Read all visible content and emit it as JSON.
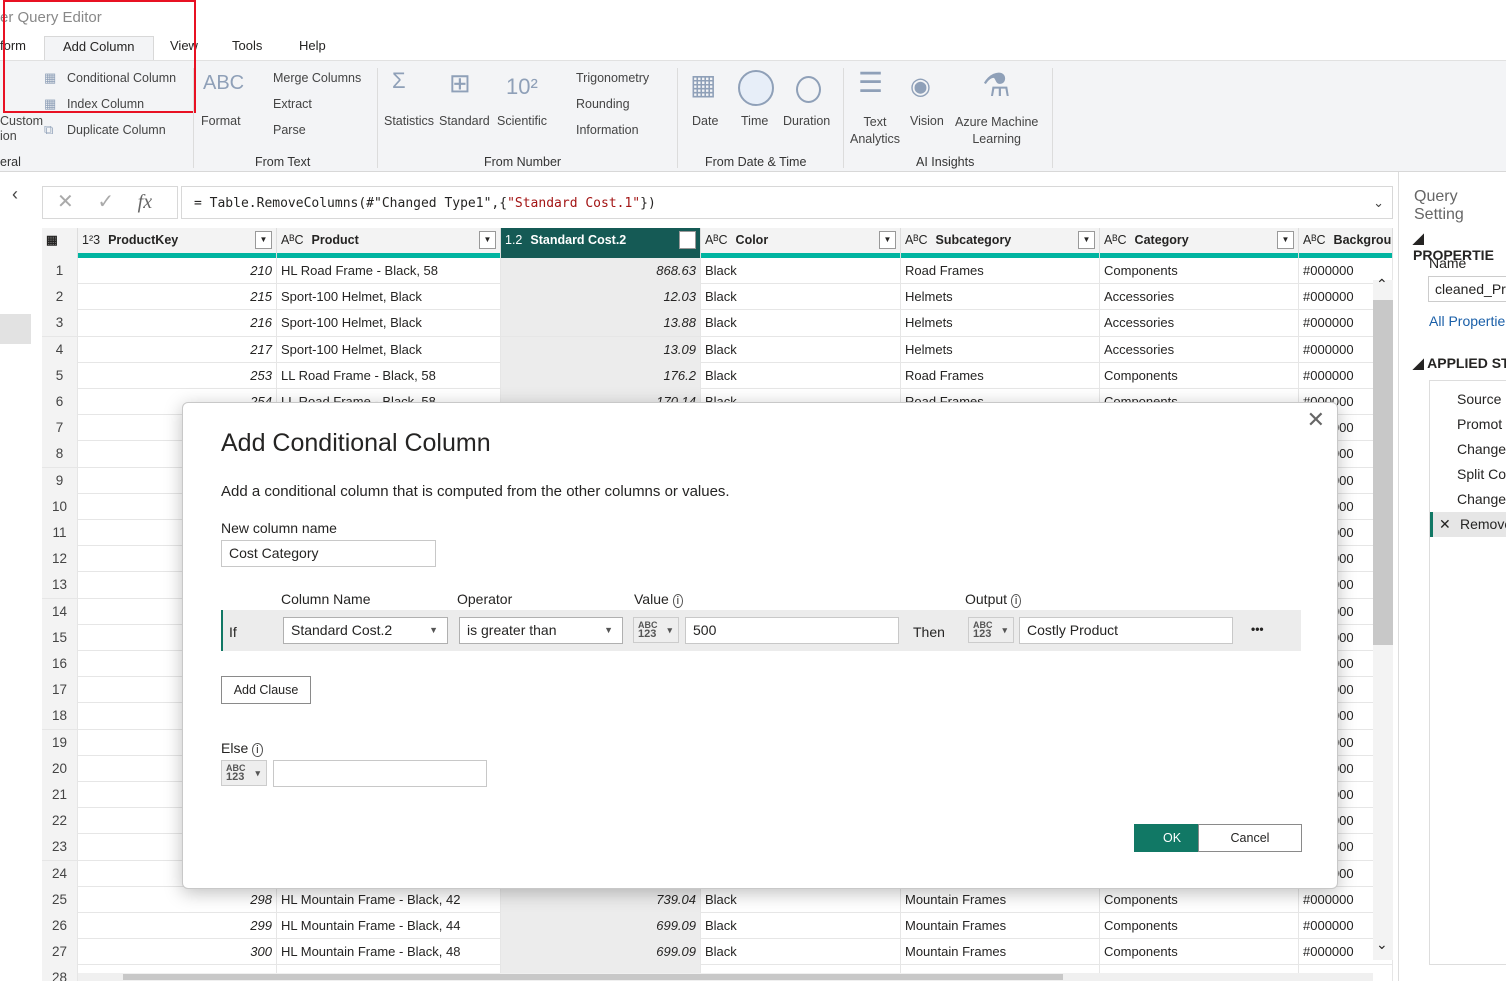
{
  "window": {
    "title": "er Query Editor"
  },
  "tabs": [
    {
      "label": "form"
    },
    {
      "label": "Add Column",
      "active": true
    },
    {
      "label": "View"
    },
    {
      "label": "Tools"
    },
    {
      "label": "Help"
    }
  ],
  "ribbon": {
    "general": {
      "custom_label": "Custom\nion",
      "group": "eral",
      "conditional": "Conditional Column",
      "index": "Index Column",
      "duplicate": "Duplicate Column"
    },
    "text": {
      "format": "Format",
      "merge": "Merge Columns",
      "extract": "Extract",
      "parse": "Parse",
      "group": "From Text"
    },
    "number": {
      "statistics": "Statistics",
      "standard": "Standard",
      "scientific": "Scientific",
      "trig": "Trigonometry",
      "rounding": "Rounding",
      "information": "Information",
      "group": "From Number"
    },
    "datetime": {
      "date": "Date",
      "time": "Time",
      "duration": "Duration",
      "group": "From Date & Time"
    },
    "ai": {
      "text": "Text\nAnalytics",
      "vision": "Vision",
      "azure": "Azure Machine\nLearning",
      "group": "AI Insights"
    }
  },
  "formula": {
    "prefix": "= Table.RemoveColumns(#\"Changed Type1\",{",
    "str": "\"Standard Cost.1\"",
    "suffix": "})"
  },
  "columns": [
    {
      "type": "1²3",
      "name": "ProductKey"
    },
    {
      "type": "AᴮC",
      "name": "Product"
    },
    {
      "type": "1.2",
      "name": "Standard Cost.2",
      "selected": true
    },
    {
      "type": "AᴮC",
      "name": "Color"
    },
    {
      "type": "AᴮC",
      "name": "Subcategory"
    },
    {
      "type": "AᴮC",
      "name": "Category"
    },
    {
      "type": "AᴮC",
      "name": "Backgrour"
    }
  ],
  "rows": [
    [
      "1",
      "210",
      "HL Road Frame - Black, 58",
      "868.63",
      "Black",
      "Road Frames",
      "Components",
      "#000000"
    ],
    [
      "2",
      "215",
      "Sport-100 Helmet, Black",
      "12.03",
      "Black",
      "Helmets",
      "Accessories",
      "#000000"
    ],
    [
      "3",
      "216",
      "Sport-100 Helmet, Black",
      "13.88",
      "Black",
      "Helmets",
      "Accessories",
      "#000000"
    ],
    [
      "4",
      "217",
      "Sport-100 Helmet, Black",
      "13.09",
      "Black",
      "Helmets",
      "Accessories",
      "#000000"
    ],
    [
      "5",
      "253",
      "LL Road Frame - Black, 58",
      "176.2",
      "Black",
      "Road Frames",
      "Components",
      "#000000"
    ],
    [
      "6",
      "254",
      "LL Road Frame - Black, 58",
      "170.14",
      "Black",
      "Road Frames",
      "Components",
      "#000000"
    ],
    [
      "7",
      "",
      "",
      "",
      "",
      "",
      "",
      "#000000"
    ],
    [
      "8",
      "",
      "",
      "",
      "",
      "",
      "",
      "#000000"
    ],
    [
      "9",
      "",
      "",
      "",
      "",
      "",
      "",
      "#000000"
    ],
    [
      "10",
      "",
      "",
      "",
      "",
      "",
      "",
      "#000000"
    ],
    [
      "11",
      "",
      "",
      "",
      "",
      "",
      "",
      "#000000"
    ],
    [
      "12",
      "",
      "",
      "",
      "",
      "",
      "",
      "#000000"
    ],
    [
      "13",
      "",
      "",
      "",
      "",
      "",
      "",
      "#000000"
    ],
    [
      "14",
      "",
      "",
      "",
      "",
      "",
      "",
      "#000000"
    ],
    [
      "15",
      "",
      "",
      "",
      "",
      "",
      "",
      "#000000"
    ],
    [
      "16",
      "",
      "",
      "",
      "",
      "",
      "",
      "#000000"
    ],
    [
      "17",
      "",
      "",
      "",
      "",
      "",
      "",
      "#000000"
    ],
    [
      "18",
      "",
      "",
      "",
      "",
      "",
      "",
      "#000000"
    ],
    [
      "19",
      "",
      "",
      "",
      "",
      "",
      "",
      "#000000"
    ],
    [
      "20",
      "",
      "",
      "",
      "",
      "",
      "",
      "#000000"
    ],
    [
      "21",
      "",
      "",
      "",
      "",
      "",
      "",
      "#000000"
    ],
    [
      "22",
      "",
      "",
      "",
      "",
      "",
      "",
      "#000000"
    ],
    [
      "23",
      "",
      "",
      "",
      "",
      "",
      "",
      "#000000"
    ],
    [
      "24",
      "",
      "",
      "",
      "",
      "",
      "",
      "#000000"
    ],
    [
      "25",
      "298",
      "HL Mountain Frame - Black, 42",
      "739.04",
      "Black",
      "Mountain Frames",
      "Components",
      "#000000"
    ],
    [
      "26",
      "299",
      "HL Mountain Frame - Black, 44",
      "699.09",
      "Black",
      "Mountain Frames",
      "Components",
      "#000000"
    ],
    [
      "27",
      "300",
      "HL Mountain Frame - Black, 48",
      "699.09",
      "Black",
      "Mountain Frames",
      "Components",
      "#000000"
    ],
    [
      "28",
      "",
      "",
      "",
      "",
      "",
      "",
      ""
    ]
  ],
  "query_settings": {
    "title": "Query Setting",
    "properties": "PROPERTIE",
    "name_label": "Name",
    "name_value": "cleaned_Pro",
    "all_props": "All Propertie",
    "applied": "APPLIED ST",
    "steps": [
      "Source",
      "Promot",
      "Change",
      "Split Co",
      "Change",
      "Remove"
    ]
  },
  "dialog": {
    "title": "Add Conditional Column",
    "description": "Add a conditional column that is computed from the other columns or values.",
    "new_col_label": "New column name",
    "new_col_value": "Cost Category",
    "h_column": "Column Name",
    "h_operator": "Operator",
    "h_value": "Value",
    "h_output": "Output",
    "if": "If",
    "column": "Standard Cost.2",
    "operator": "is greater than",
    "value": "500",
    "then": "Then",
    "output": "Costly Product",
    "type_abc": "ABC",
    "type_123": "123",
    "more": "•••",
    "add_clause": "Add Clause",
    "else": "Else",
    "else_value": "",
    "ok": "OK",
    "cancel": "Cancel"
  },
  "colors": {
    "accent": "#117865",
    "header_bar": "#00b4a0",
    "highlight_box": "#e81123"
  }
}
